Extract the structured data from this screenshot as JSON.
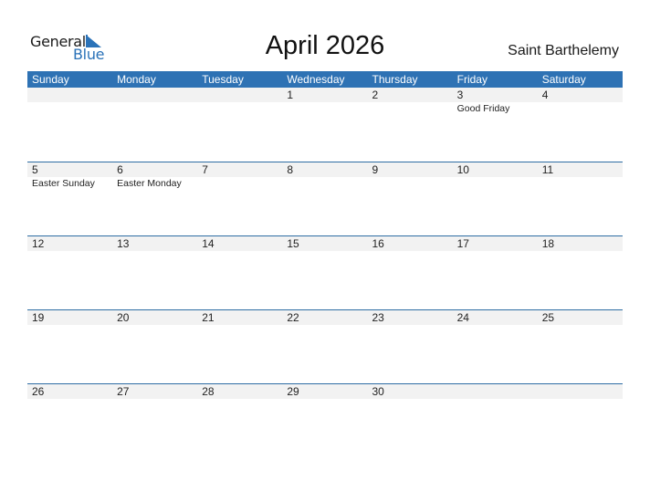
{
  "logo": {
    "line1": "General",
    "line2": "Blue",
    "brand_color": "#2a72b8"
  },
  "title": "April 2026",
  "country": "Saint Barthelemy",
  "colors": {
    "header_bg": "#2e72b4",
    "date_strip_bg": "#f2f2f2",
    "week_border": "#2e6da4"
  },
  "weekdays": [
    "Sunday",
    "Monday",
    "Tuesday",
    "Wednesday",
    "Thursday",
    "Friday",
    "Saturday"
  ],
  "weeks": [
    [
      {
        "date": "",
        "holiday": ""
      },
      {
        "date": "",
        "holiday": ""
      },
      {
        "date": "",
        "holiday": ""
      },
      {
        "date": "1",
        "holiday": ""
      },
      {
        "date": "2",
        "holiday": ""
      },
      {
        "date": "3",
        "holiday": "Good Friday"
      },
      {
        "date": "4",
        "holiday": ""
      }
    ],
    [
      {
        "date": "5",
        "holiday": "Easter Sunday"
      },
      {
        "date": "6",
        "holiday": "Easter Monday"
      },
      {
        "date": "7",
        "holiday": ""
      },
      {
        "date": "8",
        "holiday": ""
      },
      {
        "date": "9",
        "holiday": ""
      },
      {
        "date": "10",
        "holiday": ""
      },
      {
        "date": "11",
        "holiday": ""
      }
    ],
    [
      {
        "date": "12",
        "holiday": ""
      },
      {
        "date": "13",
        "holiday": ""
      },
      {
        "date": "14",
        "holiday": ""
      },
      {
        "date": "15",
        "holiday": ""
      },
      {
        "date": "16",
        "holiday": ""
      },
      {
        "date": "17",
        "holiday": ""
      },
      {
        "date": "18",
        "holiday": ""
      }
    ],
    [
      {
        "date": "19",
        "holiday": ""
      },
      {
        "date": "20",
        "holiday": ""
      },
      {
        "date": "21",
        "holiday": ""
      },
      {
        "date": "22",
        "holiday": ""
      },
      {
        "date": "23",
        "holiday": ""
      },
      {
        "date": "24",
        "holiday": ""
      },
      {
        "date": "25",
        "holiday": ""
      }
    ],
    [
      {
        "date": "26",
        "holiday": ""
      },
      {
        "date": "27",
        "holiday": ""
      },
      {
        "date": "28",
        "holiday": ""
      },
      {
        "date": "29",
        "holiday": ""
      },
      {
        "date": "30",
        "holiday": ""
      },
      {
        "date": "",
        "holiday": ""
      },
      {
        "date": "",
        "holiday": ""
      }
    ]
  ]
}
